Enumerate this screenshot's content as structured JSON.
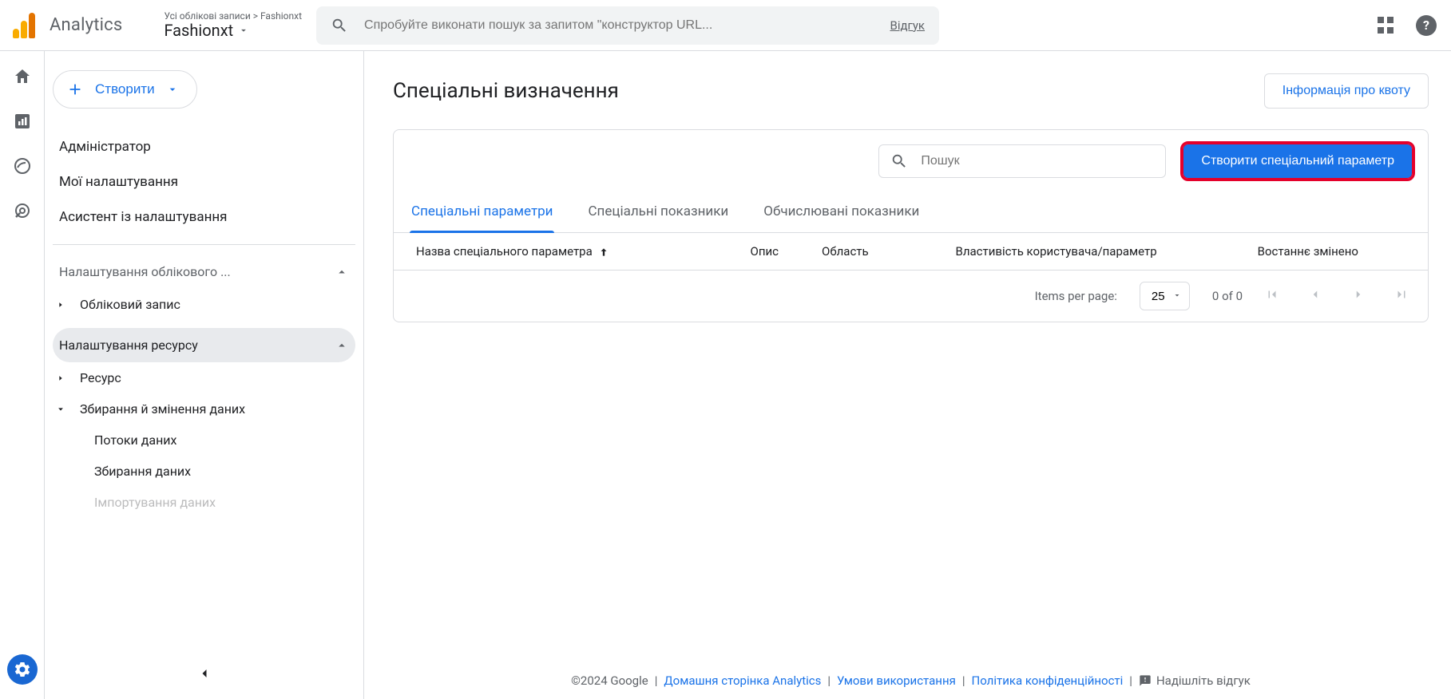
{
  "header": {
    "app_name": "Analytics",
    "breadcrumb": "Усі облікові записи > Fashionxt",
    "property": "Fashionxt",
    "search_placeholder": "Спробуйте виконати пошук за запитом \"конструктор URL...",
    "feedback_link": "Відгук"
  },
  "admin": {
    "create_label": "Створити",
    "links": {
      "administrator": "Адміністратор",
      "my_settings": "Мої налаштування",
      "setup_assistant": "Асистент із налаштування"
    },
    "account_section": {
      "label": "Налаштування облікового ...",
      "items": {
        "account": "Обліковий запис"
      }
    },
    "property_section": {
      "label": "Налаштування ресурсу",
      "items": {
        "resource": "Ресурс",
        "data_collection": "Збирання й змінення даних",
        "data_streams": "Потоки даних",
        "collection": "Збирання даних",
        "import": "Імпортування даних"
      }
    }
  },
  "page": {
    "title": "Спеціальні визначення",
    "quota_btn": "Інформація про квоту",
    "search_placeholder": "Пошук",
    "create_param_btn": "Створити спеціальний параметр",
    "tabs": {
      "dimensions": "Спеціальні параметри",
      "metrics": "Спеціальні показники",
      "calculated": "Обчислювані показники"
    },
    "columns": {
      "name": "Назва спеціального параметра",
      "description": "Опис",
      "scope": "Область",
      "user_property": "Властивість користувача/параметр",
      "last_changed": "Востаннє змінено"
    },
    "pager": {
      "items_per_page": "Items per page:",
      "page_size": "25",
      "range": "0 of 0"
    }
  },
  "footer": {
    "copyright": "©2024 Google",
    "analytics_home": "Домашня сторінка Analytics",
    "terms": "Умови використання",
    "privacy": "Політика конфіденційності",
    "send_feedback": "Надішліть відгук"
  }
}
